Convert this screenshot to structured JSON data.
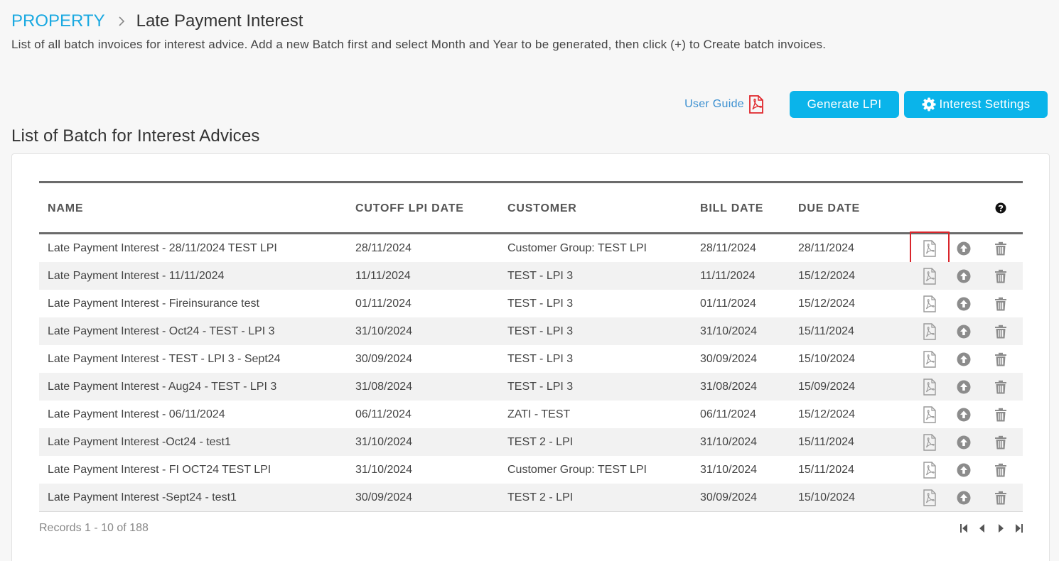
{
  "breadcrumb": {
    "root": "PROPERTY",
    "current": "Late Payment Interest"
  },
  "description": "List of all batch invoices for interest advice. Add a new Batch first and select Month and Year to be generated, then click (+) to Create batch invoices.",
  "toolbar": {
    "user_guide": "User Guide",
    "generate_label": "Generate LPI",
    "settings_label": "Interest Settings"
  },
  "section_title": "List of Batch for Interest Advices",
  "table": {
    "columns": {
      "name": "NAME",
      "cutoff": "CUTOFF LPI DATE",
      "customer": "CUSTOMER",
      "bill": "BILL DATE",
      "due": "DUE DATE"
    },
    "rows": [
      {
        "name": "Late Payment Interest - 28/11/2024 TEST LPI",
        "cutoff": "28/11/2024",
        "customer": "Customer Group: TEST LPI",
        "bill": "28/11/2024",
        "due": "28/11/2024"
      },
      {
        "name": "Late Payment Interest - 11/11/2024",
        "cutoff": "11/11/2024",
        "customer": "TEST - LPI 3",
        "bill": "11/11/2024",
        "due": "15/12/2024"
      },
      {
        "name": "Late Payment Interest - Fireinsurance test",
        "cutoff": "01/11/2024",
        "customer": "TEST - LPI 3",
        "bill": "01/11/2024",
        "due": "15/12/2024"
      },
      {
        "name": "Late Payment Interest - Oct24 - TEST - LPI 3",
        "cutoff": "31/10/2024",
        "customer": "TEST - LPI 3",
        "bill": "31/10/2024",
        "due": "15/11/2024"
      },
      {
        "name": "Late Payment Interest - TEST - LPI 3 - Sept24",
        "cutoff": "30/09/2024",
        "customer": "TEST - LPI 3",
        "bill": "30/09/2024",
        "due": "15/10/2024"
      },
      {
        "name": "Late Payment Interest - Aug24 - TEST - LPI 3",
        "cutoff": "31/08/2024",
        "customer": "TEST - LPI 3",
        "bill": "31/08/2024",
        "due": "15/09/2024"
      },
      {
        "name": "Late Payment Interest - 06/11/2024",
        "cutoff": "06/11/2024",
        "customer": "ZATI - TEST",
        "bill": "06/11/2024",
        "due": "15/12/2024"
      },
      {
        "name": "Late Payment Interest -Oct24 - test1",
        "cutoff": "31/10/2024",
        "customer": "TEST 2 - LPI",
        "bill": "31/10/2024",
        "due": "15/11/2024"
      },
      {
        "name": "Late Payment Interest - FI OCT24 TEST LPI",
        "cutoff": "31/10/2024",
        "customer": "Customer Group: TEST LPI",
        "bill": "31/10/2024",
        "due": "15/11/2024"
      },
      {
        "name": "Late Payment Interest -Sept24 - test1",
        "cutoff": "30/09/2024",
        "customer": "TEST 2 - LPI",
        "bill": "30/09/2024",
        "due": "15/10/2024"
      }
    ]
  },
  "records_label": "Records 1 - 10 of 188",
  "colors": {
    "accent": "#0ab4ea",
    "breadcrumb": "#1aa9e1",
    "highlight": "#d9262c",
    "pdf_red": "#e0262b"
  },
  "icons": [
    "chevron-right-icon",
    "pdf-icon",
    "gear-icon",
    "help-icon",
    "upload-icon",
    "trash-icon",
    "first-page-icon",
    "prev-page-icon",
    "next-page-icon",
    "last-page-icon"
  ]
}
